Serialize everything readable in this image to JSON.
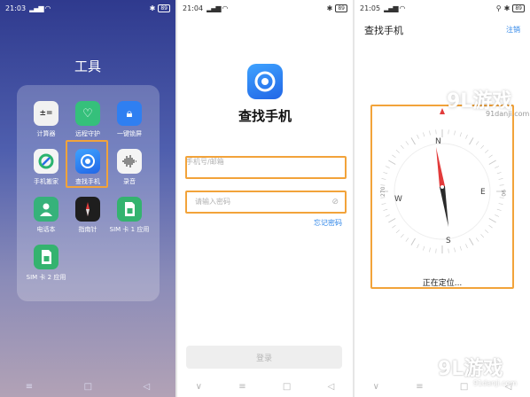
{
  "panel1": {
    "status": {
      "time": "21:03",
      "battery": "89"
    },
    "folder_title": "工具",
    "apps": [
      {
        "label": "计算器",
        "icon": "calculator-icon",
        "color": "#f1f1f1"
      },
      {
        "label": "远程守护",
        "icon": "heart-shield-icon",
        "color": "#35c07b"
      },
      {
        "label": "一键锁屏",
        "icon": "lock-icon",
        "color": "#2f7ff1"
      },
      {
        "label": "手机搬家",
        "icon": "phone-clone-icon",
        "color": "#f4f4f4"
      },
      {
        "label": "查找手机",
        "icon": "find-phone-icon",
        "color": "#2a6ee6"
      },
      {
        "label": "录音",
        "icon": "recorder-icon",
        "color": "#f4f4f4"
      },
      {
        "label": "电话本",
        "icon": "contacts-icon",
        "color": "#36b27a"
      },
      {
        "label": "指南针",
        "icon": "compass-icon",
        "color": "#1e1e1e"
      },
      {
        "label": "SIM 卡 1 应用",
        "icon": "sim-card-icon",
        "color": "#34b36f"
      },
      {
        "label": "SIM 卡 2 应用",
        "icon": "sim-card-icon",
        "color": "#34b36f"
      }
    ],
    "highlight_color": "#f2a33a"
  },
  "panel2": {
    "status": {
      "time": "21:04",
      "battery": "89"
    },
    "app_name": "查找手机",
    "account_placeholder": "手机号/邮箱",
    "password_placeholder": "请输入密码",
    "forgot_password": "忘记密码",
    "login_button": "登录",
    "accent": "#2f86e8"
  },
  "panel3": {
    "status": {
      "time": "21:05",
      "battery": "89"
    },
    "title": "查找手机",
    "cancel": "注销",
    "compass": {
      "N": "N",
      "E": "E",
      "S": "S",
      "W": "W",
      "tick_270": "270",
      "tick_90": "90"
    },
    "locating_text": "正在定位..."
  },
  "watermarks": {
    "top_logo": "9L游戏",
    "top_url": "91danji.com",
    "bottom_logo": "9L游戏",
    "bottom_url": "91danji.com"
  },
  "navbar": {
    "menu": "≡",
    "home": "□",
    "back": "◁",
    "down": "∨"
  }
}
